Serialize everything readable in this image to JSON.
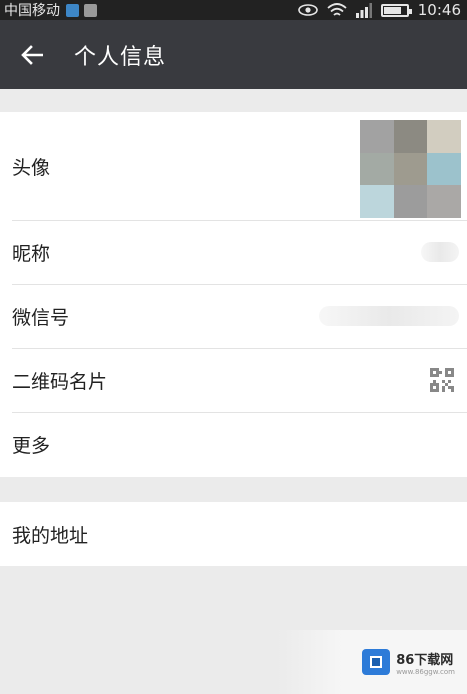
{
  "status_bar": {
    "carrier": "中国移动",
    "time": "10:46",
    "battery_level": 0.8
  },
  "header": {
    "title": "个人信息"
  },
  "profile_section": {
    "rows": [
      {
        "label": "头像"
      },
      {
        "label": "昵称"
      },
      {
        "label": "微信号"
      },
      {
        "label": "二维码名片"
      },
      {
        "label": "更多"
      }
    ]
  },
  "address_section": {
    "label": "我的地址"
  },
  "avatar_colors": [
    "#a2a2a2",
    "#8c8a82",
    "#d2cdc0",
    "#a3aaa4",
    "#9e9b8f",
    "#9cc2cc",
    "#bcd6dc",
    "#9c9c9c",
    "#aaa8a6"
  ],
  "watermark": {
    "name": "86下载网",
    "url": "www.86ggw.com"
  }
}
